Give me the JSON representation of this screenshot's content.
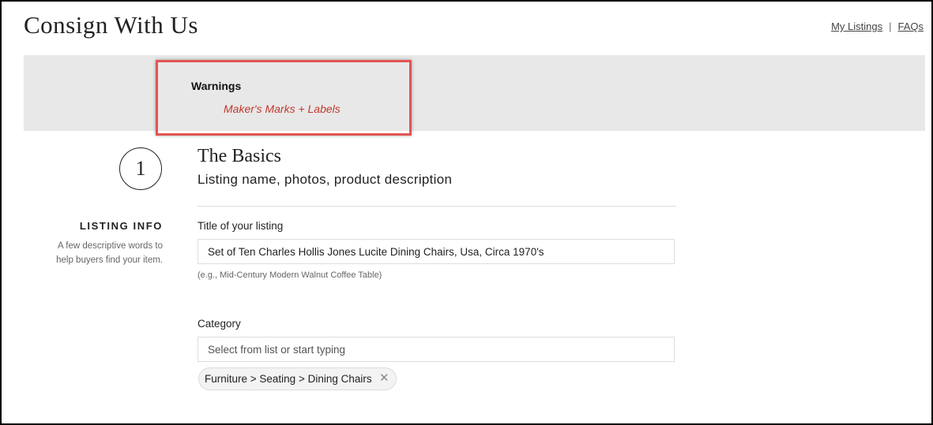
{
  "header": {
    "title": "Consign With Us",
    "links": {
      "my_listings": "My Listings",
      "separator": "|",
      "faqs": "FAQs"
    }
  },
  "warnings": {
    "heading": "Warnings",
    "items": [
      "Maker's Marks + Labels"
    ],
    "highlight_color": "#e25555",
    "link_color": "#c0392b"
  },
  "step": {
    "number": "1",
    "section_label": "LISTING INFO",
    "section_help": "A few descriptive words to help buyers find your item.",
    "title": "The Basics",
    "subtitle": "Listing name, photos, product description"
  },
  "form": {
    "title_field": {
      "label": "Title of your listing",
      "value": "Set of Ten Charles Hollis Jones Lucite Dining Chairs, Usa, Circa 1970's",
      "hint": "(e.g., Mid-Century Modern Walnut Coffee Table)"
    },
    "category_field": {
      "label": "Category",
      "placeholder": "Select from list or start typing",
      "value": "",
      "selected_chip": "Furniture > Seating > Dining Chairs",
      "remove_icon": "close-icon"
    }
  }
}
